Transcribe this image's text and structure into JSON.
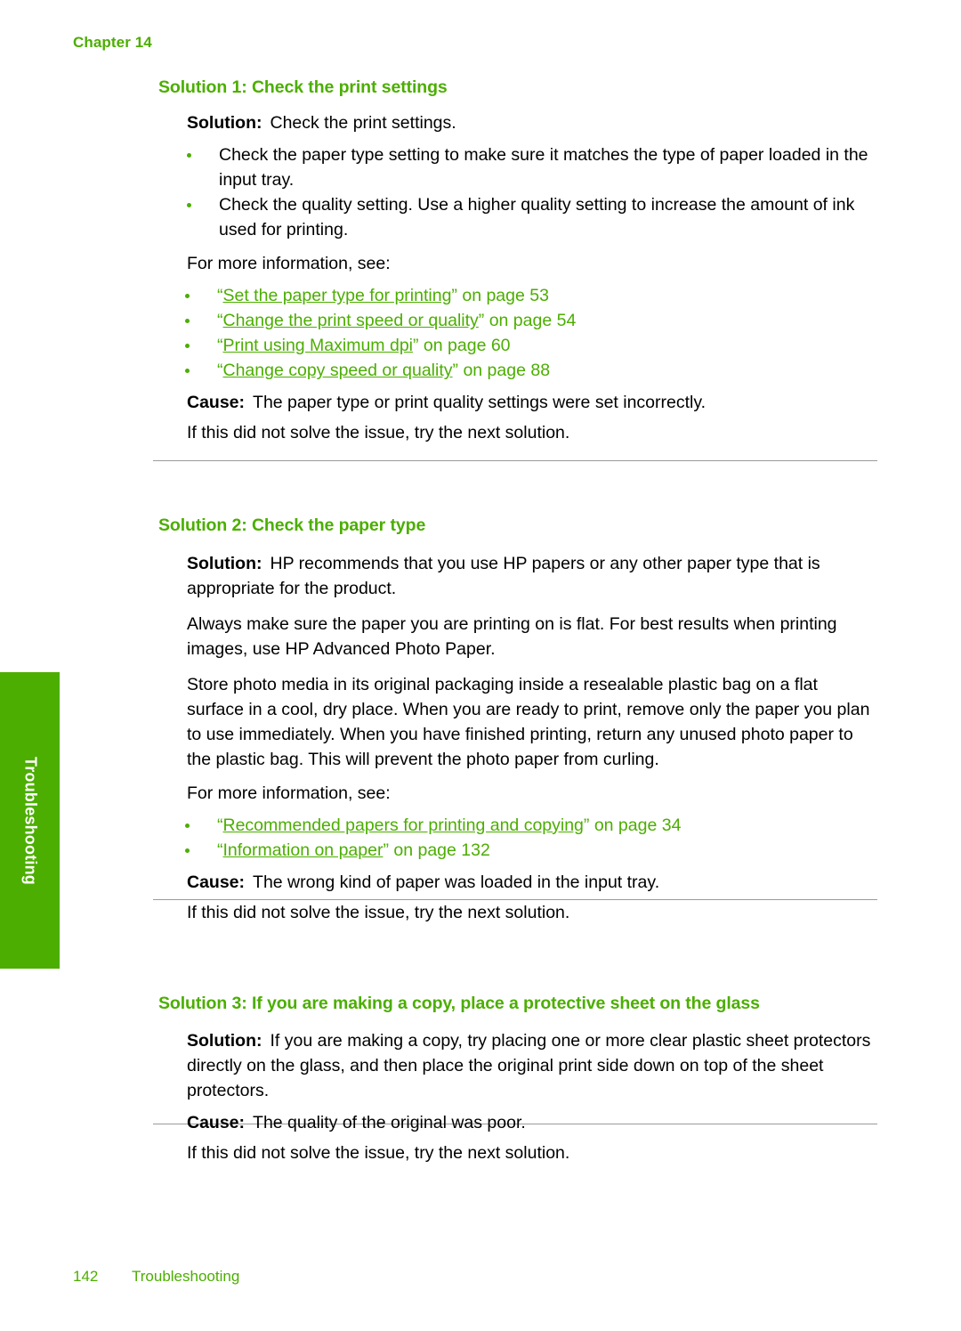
{
  "running_head": {
    "chapter": "Chapter 14"
  },
  "side_tab": {
    "label": "Troubleshooting",
    "color": "#4CAE00"
  },
  "theme": {
    "accent_green": "#4CAE00",
    "rule_gray": "#9a9a9a",
    "body_black": "#000000"
  },
  "labels": {
    "solution": "Solution:",
    "cause": "Cause:",
    "for_more_info": "For more information, see:",
    "next_solution": "If this did not solve the issue, try the next solution."
  },
  "sections": [
    {
      "heading": "Solution 1: Check the print settings",
      "solution_text": "Check the print settings.",
      "bullets": [
        "Check the paper type setting to make sure it matches the type of paper loaded in the input tray.",
        "Check the quality setting. Use a higher quality setting to increase the amount of ink used for printing."
      ],
      "links": [
        {
          "title": "Set the paper type for printing",
          "tail": "on page 53",
          "page": "53"
        },
        {
          "title": "Change the print speed or quality",
          "tail": "on page 54",
          "page": "54"
        },
        {
          "title": "Print using Maximum dpi",
          "tail": "on page 60",
          "page": "60"
        },
        {
          "title": "Change copy speed or quality",
          "tail": "on page 88",
          "page": "88"
        }
      ],
      "cause_text": "The paper type or print quality settings were set incorrectly.",
      "next_text": "If this did not solve the issue, try the next solution."
    },
    {
      "heading": "Solution 2: Check the paper type",
      "solution_text": "HP recommends that you use HP papers or any other paper type that is appropriate for the product.",
      "paragraphs": [
        "Always make sure the paper you are printing on is flat. For best results when printing images, use HP Advanced Photo Paper.",
        "Store photo media in its original packaging inside a resealable plastic bag on a flat surface in a cool, dry place. When you are ready to print, remove only the paper you plan to use immediately. When you have finished printing, return any unused photo paper to the plastic bag. This will prevent the photo paper from curling."
      ],
      "links": [
        {
          "title": "Recommended papers for printing and copying",
          "tail": "on page 34",
          "page": "34"
        },
        {
          "title": "Information on paper",
          "tail": "on page 132",
          "page": "132"
        }
      ],
      "cause_text": "The wrong kind of paper was loaded in the input tray.",
      "next_text": "If this did not solve the issue, try the next solution."
    },
    {
      "heading": "Solution 3: If you are making a copy, place a protective sheet on the glass",
      "solution_text": "If you are making a copy, try placing one or more clear plastic sheet protectors directly on the glass, and then place the original print side down on top of the sheet protectors.",
      "cause_text": "The quality of the original was poor.",
      "next_text": "If this did not solve the issue, try the next solution."
    }
  ],
  "footer": {
    "page_number": "142",
    "section_name": "Troubleshooting"
  }
}
